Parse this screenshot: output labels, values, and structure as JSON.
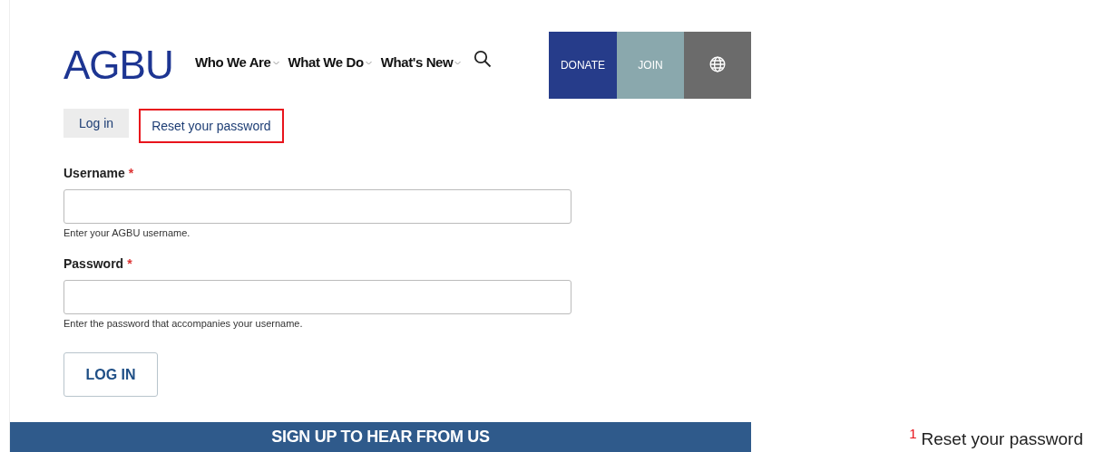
{
  "logo": "AGBU",
  "nav": [
    {
      "label": "Who We Are",
      "has_menu": true
    },
    {
      "label": "What We Do",
      "has_menu": true
    },
    {
      "label": "What's New",
      "has_menu": true
    }
  ],
  "actions": [
    {
      "kind": "donate",
      "label": "DONATE"
    },
    {
      "kind": "join",
      "label": "JOIN"
    },
    {
      "kind": "language"
    }
  ],
  "tabs": [
    {
      "label": "Log in",
      "selected": true,
      "highlighted": false
    },
    {
      "label": "Reset your password",
      "selected": false,
      "highlighted": true
    }
  ],
  "fields": [
    {
      "label": "Username",
      "required_mark": "*",
      "description": "Enter your AGBU username."
    },
    {
      "label": "Password",
      "required_mark": "*",
      "description": "Enter the password that accompanies your username."
    }
  ],
  "submit": "LOG IN",
  "signup_banner": "SIGN UP TO HEAR FROM US",
  "footnote": {
    "marker": "1",
    "text": "Reset your password"
  }
}
